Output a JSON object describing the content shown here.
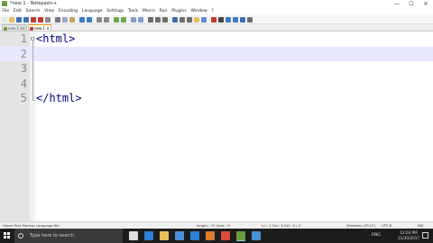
{
  "window": {
    "title": "*new 1 - Notepad++",
    "min": "—",
    "max": "☐",
    "close": "✕"
  },
  "menu": [
    "File",
    "Edit",
    "Search",
    "View",
    "Encoding",
    "Language",
    "Settings",
    "Tools",
    "Macro",
    "Run",
    "Plugins",
    "Window",
    "?"
  ],
  "toolbar": {
    "buttons": [
      {
        "name": "new-file-icon",
        "color": "#e9e9e9"
      },
      {
        "name": "open-file-icon",
        "color": "#e8c15a"
      },
      {
        "name": "save-icon",
        "color": "#3f6fb5"
      },
      {
        "name": "save-all-icon",
        "color": "#3f6fb5"
      },
      {
        "name": "close-icon",
        "color": "#c0392b"
      },
      {
        "name": "close-all-icon",
        "color": "#c0392b"
      },
      {
        "name": "print-icon",
        "color": "#8a8a8a"
      },
      {
        "name": "cut-icon",
        "color": "#777777"
      },
      {
        "name": "copy-icon",
        "color": "#9aa9c4"
      },
      {
        "name": "paste-icon",
        "color": "#c7a25c"
      },
      {
        "name": "undo-icon",
        "color": "#3d7bc6"
      },
      {
        "name": "redo-icon",
        "color": "#3d7bc6"
      },
      {
        "name": "find-icon",
        "color": "#8a8a8a"
      },
      {
        "name": "replace-icon",
        "color": "#8a8a8a"
      },
      {
        "name": "zoom-in-icon",
        "color": "#6aa84f"
      },
      {
        "name": "zoom-out-icon",
        "color": "#6aa84f"
      },
      {
        "name": "sync-v-icon",
        "color": "#7f9fc9"
      },
      {
        "name": "sync-h-icon",
        "color": "#7f9fc9"
      },
      {
        "name": "word-wrap-icon",
        "color": "#6d6d6d"
      },
      {
        "name": "show-all-icon",
        "color": "#6d6d6d"
      },
      {
        "name": "indent-guide-icon",
        "color": "#6d6d6d"
      },
      {
        "name": "lang-icon",
        "color": "#3b6ea8"
      },
      {
        "name": "doc-map-icon",
        "color": "#6d6d6d"
      },
      {
        "name": "function-list-icon",
        "color": "#6d6d6d"
      },
      {
        "name": "folder-workspace-icon",
        "color": "#e8c15a"
      },
      {
        "name": "monitor-icon",
        "color": "#5a8fd0"
      },
      {
        "name": "record-macro-icon",
        "color": "#c0392b"
      },
      {
        "name": "stop-macro-icon",
        "color": "#444444"
      },
      {
        "name": "play-macro-icon",
        "color": "#3d7bc6"
      },
      {
        "name": "run-macro-icon",
        "color": "#3d7bc6"
      },
      {
        "name": "save-macro-icon",
        "color": "#3f6fb5"
      },
      {
        "name": "spell-check-icon",
        "color": "#6d6d6d"
      }
    ]
  },
  "tabs": [
    {
      "label": "new 1.txt",
      "color": "#6a9d3f"
    },
    {
      "label": "new 1 ✕",
      "color": "#c0392b"
    }
  ],
  "editor": {
    "lines": [
      {
        "num": "1",
        "text": "<html>"
      },
      {
        "num": "2",
        "text": ""
      },
      {
        "num": "3",
        "text": ""
      },
      {
        "num": "4",
        "text": ""
      },
      {
        "num": "5",
        "text": "</html>"
      }
    ],
    "current_line": 2
  },
  "status": {
    "doc_type": "Hyper Text Markup Language file",
    "length": "length : 22   lines : 5",
    "position": "Ln : 2   Col : 5   Sel : 0 | 0",
    "eol": "Windows (CR LF)",
    "encoding": "UTF-8",
    "mode": "INS"
  },
  "taskbar": {
    "search_placeholder": "Type here to search",
    "apps": [
      {
        "name": "task-view-icon",
        "color": "#dddddd"
      },
      {
        "name": "edge-icon",
        "color": "#2f7fd6"
      },
      {
        "name": "explorer-icon",
        "color": "#e8c15a"
      },
      {
        "name": "store-icon",
        "color": "#4a90d9"
      },
      {
        "name": "mail-icon",
        "color": "#2f7fd6"
      },
      {
        "name": "firefox-icon",
        "color": "#e07a2f"
      },
      {
        "name": "chrome-icon",
        "color": "#dd4b39"
      },
      {
        "name": "notepadpp-icon",
        "color": "#6a9d3f"
      },
      {
        "name": "photos-icon",
        "color": "#4a90d9"
      }
    ],
    "language": "ENG",
    "time": "12:03 PM",
    "date": "11/30/2017"
  }
}
